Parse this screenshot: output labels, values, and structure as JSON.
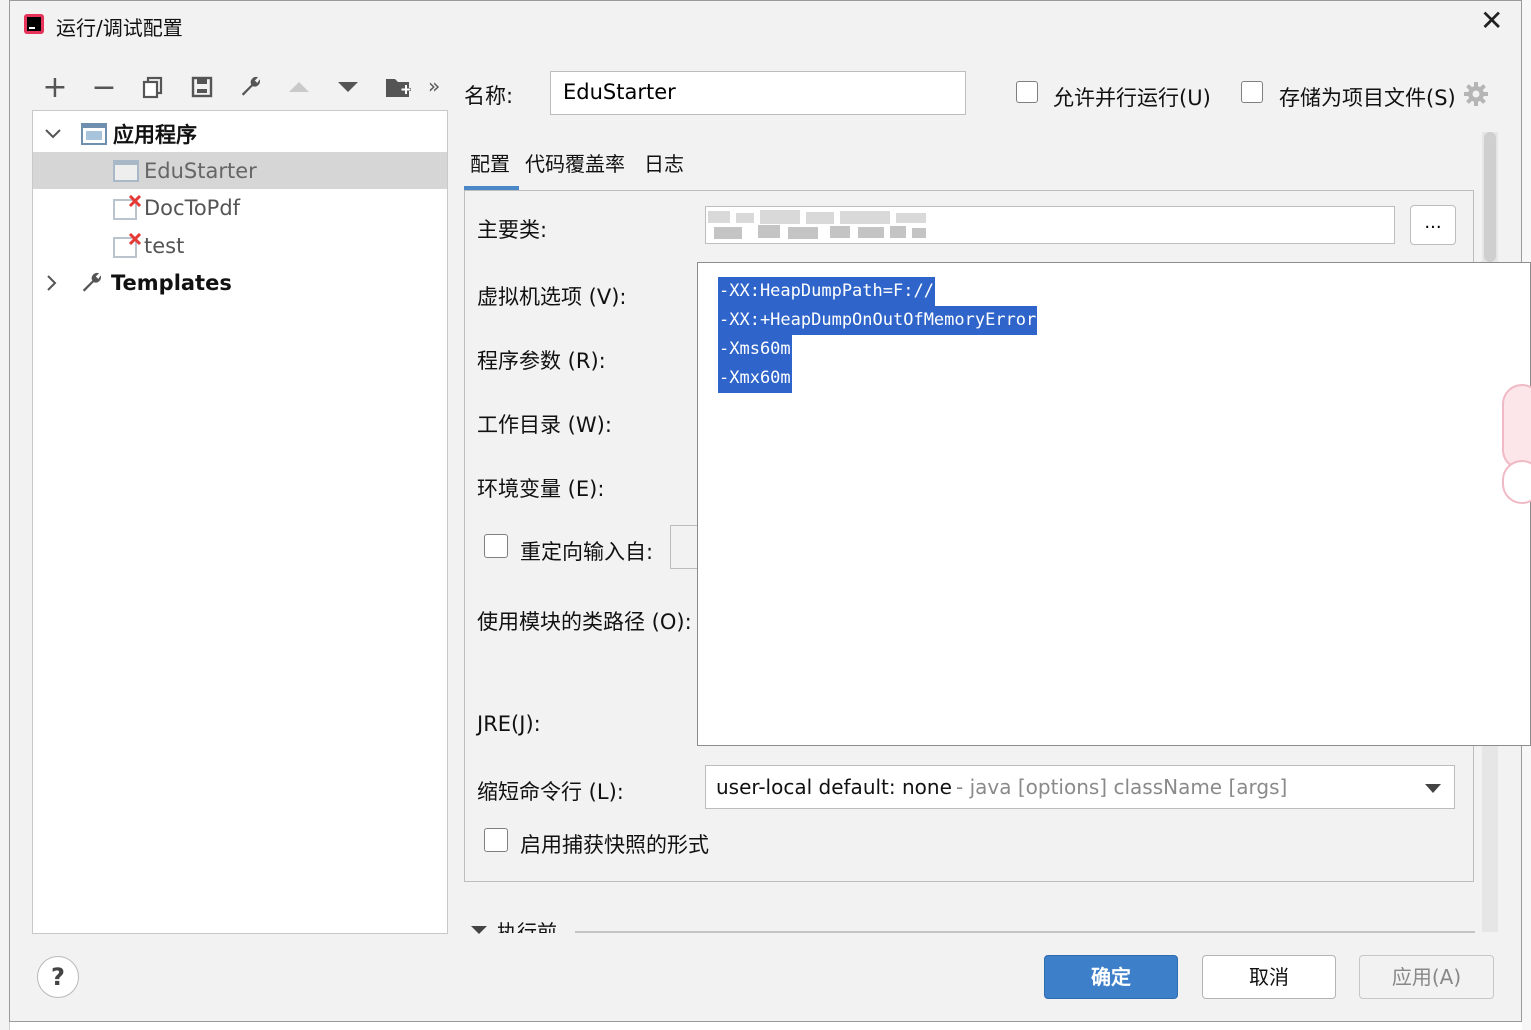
{
  "window": {
    "title": "运行/调试配置",
    "close_glyph": "✕"
  },
  "toolbar": {
    "add": "+",
    "remove": "−",
    "more": "»"
  },
  "tree": {
    "root_label": "应用程序",
    "items": [
      {
        "label": "EduStarter",
        "selected": true,
        "error": false
      },
      {
        "label": "DocToPdf",
        "selected": false,
        "error": true
      },
      {
        "label": "test",
        "selected": false,
        "error": true
      }
    ],
    "templates_label": "Templates"
  },
  "header": {
    "name_label": "名称:",
    "name_value": "EduStarter",
    "allow_parallel": "允许并行运行(U)",
    "store_as_file": "存储为项目文件(S)"
  },
  "tabs": [
    {
      "label": "配置",
      "active": true
    },
    {
      "label": "代码覆盖率",
      "active": false
    },
    {
      "label": "日志",
      "active": false
    }
  ],
  "form": {
    "main_class_label": "主要类:",
    "browse_label": "...",
    "vm_options_label": "虚拟机选项 (V):",
    "program_args_label": "程序参数 (R):",
    "working_dir_label": "工作目录 (W):",
    "env_vars_label": "环境变量 (E):",
    "redirect_input_label": "重定向输入自:",
    "module_classpath_label": "使用模块的类路径 (O):",
    "jre_label": "JRE(J):",
    "shorten_cmd_label": "缩短命令行 (L):",
    "shorten_cmd_value": "user-local default: none",
    "shorten_cmd_hint": " - java [options] className [args]",
    "snapshot_label": "启用捕获快照的形式"
  },
  "vm_options_lines": [
    "-XX:HeapDumpPath=F://",
    "-XX:+HeapDumpOnOutOfMemoryError",
    "-Xms60m",
    "-Xmx60m"
  ],
  "before_launch_label": "执行前",
  "buttons": {
    "ok": "确定",
    "cancel": "取消",
    "apply": "应用(A)",
    "help": "?"
  },
  "colors": {
    "accent": "#3d7fc8",
    "selection": "#2f65ca",
    "error": "#e53935"
  }
}
